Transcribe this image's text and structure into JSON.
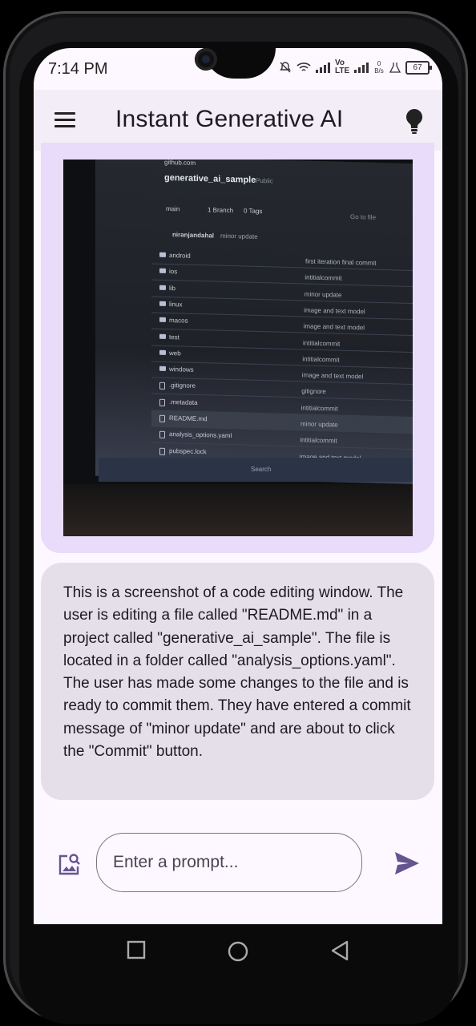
{
  "status_bar": {
    "time": "7:14 PM",
    "network_label": "Vo LTE",
    "data_rate": "0 B/s",
    "battery": "67"
  },
  "app_bar": {
    "title": "Instant Generative AI",
    "menu_icon": "hamburger-menu-icon",
    "action_icon": "lightbulb-icon"
  },
  "photo": {
    "site": "github.com",
    "repo": "generative_ai_sample",
    "visibility": "Public",
    "branch": "main",
    "branch_count": "1 Branch",
    "tag_count": "0 Tags",
    "search": "Go to file",
    "author": "niranjandahal",
    "last_commit": "minor update",
    "files": [
      {
        "name": "android",
        "commit": "first iteration final commit"
      },
      {
        "name": "ios",
        "commit": "intitialcommit"
      },
      {
        "name": "lib",
        "commit": "minor update"
      },
      {
        "name": "linux",
        "commit": "image and text model"
      },
      {
        "name": "macos",
        "commit": "image and text model"
      },
      {
        "name": "test",
        "commit": "intitialcommit"
      },
      {
        "name": "web",
        "commit": "intitialcommit"
      },
      {
        "name": "windows",
        "commit": "image and text model"
      },
      {
        "name": ".gitignore",
        "commit": "gitignore"
      },
      {
        "name": ".metadata",
        "commit": "intitialcommit"
      },
      {
        "name": "README.md",
        "commit": "minor update"
      },
      {
        "name": "analysis_options.yaml",
        "commit": "intitialcommit"
      },
      {
        "name": "pubspec.lock",
        "commit": "image and text model"
      }
    ],
    "taskbar_search": "Search"
  },
  "response": {
    "text": "This is a screenshot of a code editing window. The user is editing a file called \"README.md\" in a project called \"generative_ai_sample\". The file is located in a folder called \"analysis_options.yaml\". The user has made some changes to the file and is ready to commit them. They have entered a commit message of \"minor update\" and are about to click the \"Commit\" button."
  },
  "input": {
    "placeholder": "Enter a prompt...",
    "value": "",
    "image_icon": "image-search-icon",
    "send_icon": "send-icon"
  },
  "colors": {
    "background": "#fdf7ff",
    "appbar": "#f3edf7",
    "image_bubble": "#e8dcfa",
    "response_bubble": "#e5dfe9",
    "accent": "#65558f"
  }
}
